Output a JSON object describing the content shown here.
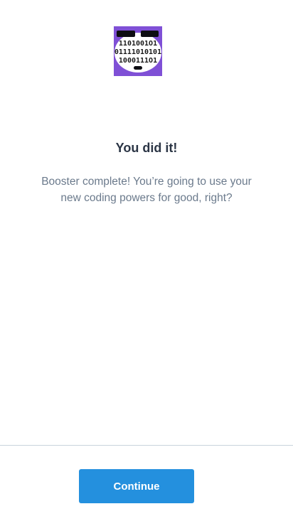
{
  "completion": {
    "badge_icon": "binary-robot-face-icon",
    "badge_color": "#7f50d6",
    "badge_binary_lines": [
      "1101001O1",
      "01111010101",
      "1000111O1"
    ],
    "title": "You did it!",
    "message_line1": "Booster complete! You’re going to use your",
    "message_line2": "new coding powers for good, right?"
  },
  "footer": {
    "continue_label": "Continue",
    "button_color": "#2490de"
  }
}
